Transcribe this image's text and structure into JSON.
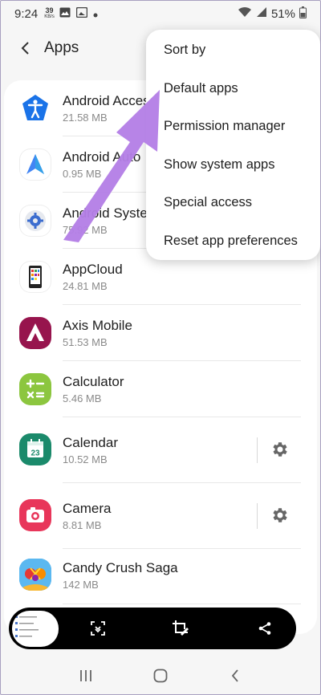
{
  "status_bar": {
    "time": "9:24",
    "data_rate_value": "39",
    "data_rate_unit": "KB/s",
    "battery": "51%"
  },
  "header": {
    "title": "Apps"
  },
  "apps": [
    {
      "name": "Android Accessibility Suite",
      "size": "21.58 MB",
      "icon": "accessibility-icon"
    },
    {
      "name": "Android Auto",
      "size": "0.95 MB",
      "icon": "android-auto-icon"
    },
    {
      "name": "Android System WebView",
      "size": "75.92 MB",
      "icon": "android-system-icon"
    },
    {
      "name": "AppCloud",
      "size": "24.81 MB",
      "icon": "appcloud-icon"
    },
    {
      "name": "Axis Mobile",
      "size": "51.53 MB",
      "icon": "axis-mobile-icon"
    },
    {
      "name": "Calculator",
      "size": "5.46 MB",
      "icon": "calculator-icon"
    },
    {
      "name": "Calendar",
      "size": "10.52 MB",
      "icon": "calendar-icon",
      "calendar_day": "23"
    },
    {
      "name": "Camera",
      "size": "8.81 MB",
      "icon": "camera-icon"
    },
    {
      "name": "Candy Crush Saga",
      "size": "142 MB",
      "icon": "candy-crush-icon"
    }
  ],
  "menu": {
    "items": [
      "Sort by",
      "Default apps",
      "Permission manager",
      "Show system apps",
      "Special access",
      "Reset app preferences"
    ]
  },
  "colors": {
    "arrow": "#b47fe6",
    "accessibility": "#1a73e8",
    "axis": "#97144d",
    "calculator": "#8cc63f",
    "calendar": "#1b8a6b",
    "camera": "#e8365a"
  }
}
